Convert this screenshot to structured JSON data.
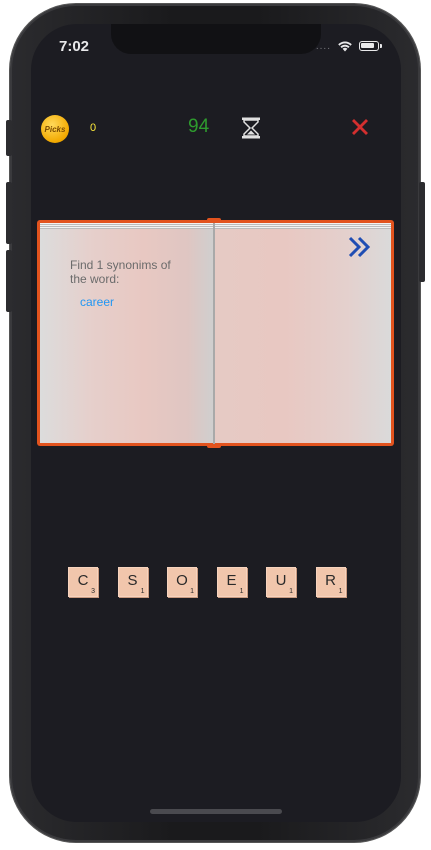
{
  "status_bar": {
    "time": "7:02",
    "signal": "...."
  },
  "header": {
    "coin_label": "Picks",
    "coins": "0",
    "timer": "94",
    "timer_color": "#2e9b2e",
    "close_color": "#d32f2f"
  },
  "book": {
    "prompt": "Find 1 synonims of the word:",
    "word": "career",
    "cover_color": "#e2531e",
    "next_color": "#1f4db3"
  },
  "tiles": [
    {
      "letter": "C",
      "score": "3"
    },
    {
      "letter": "S",
      "score": "1"
    },
    {
      "letter": "O",
      "score": "1"
    },
    {
      "letter": "E",
      "score": "1"
    },
    {
      "letter": "U",
      "score": "1"
    },
    {
      "letter": "R",
      "score": "1"
    }
  ]
}
